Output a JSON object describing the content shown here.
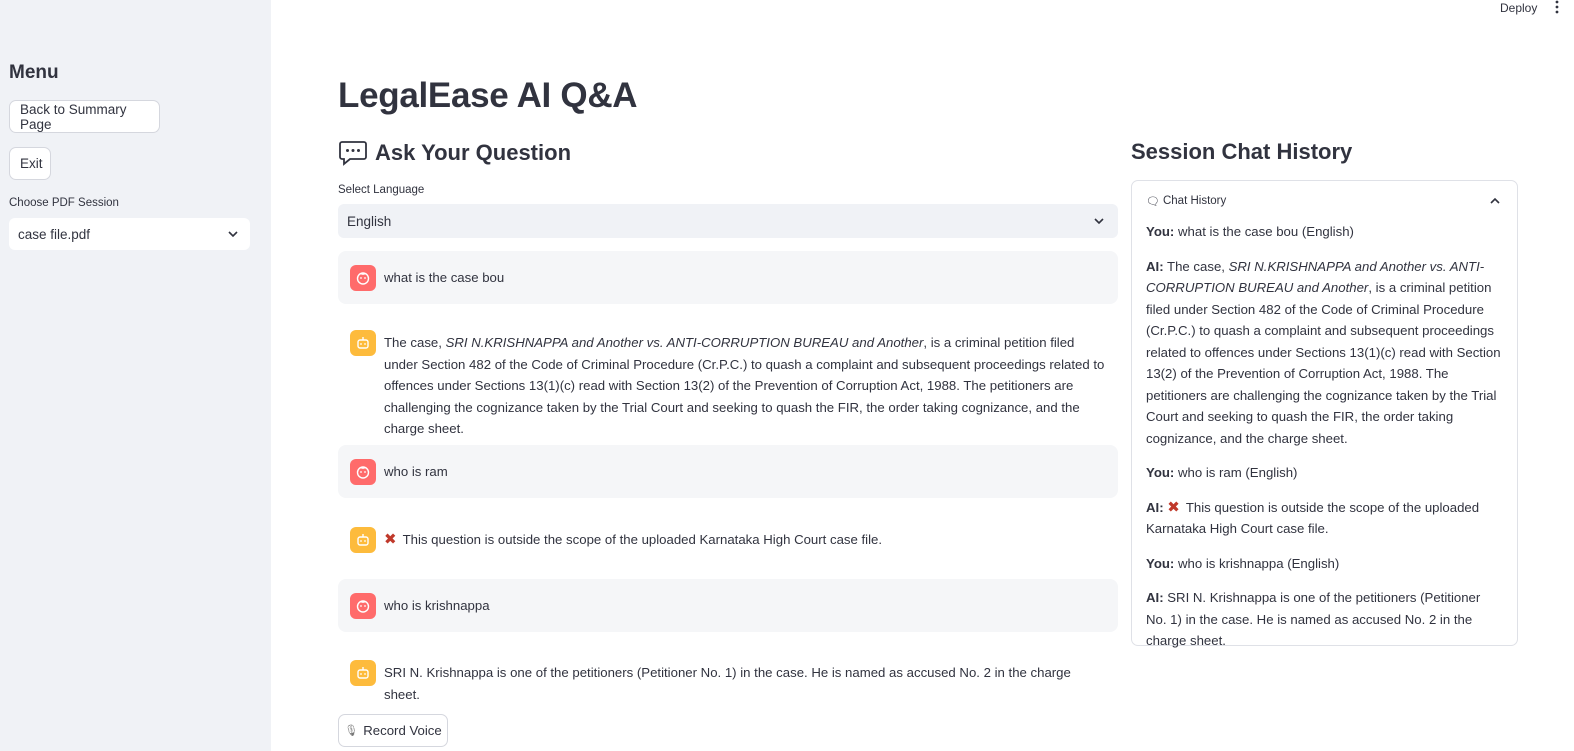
{
  "topbar": {
    "deploy_label": "Deploy",
    "menu_icon": "kebab-menu-icon"
  },
  "sidebar": {
    "title": "Menu",
    "back_button": "Back to Summary Page",
    "exit_button": "Exit",
    "session_label": "Choose PDF Session",
    "session_value": "case file.pdf"
  },
  "main": {
    "title": "LegalEase AI Q&A",
    "ask_heading": "Ask Your Question",
    "ask_icon": "speech-bubble-icon",
    "language_label": "Select Language",
    "language_value": "English",
    "record_button": "Record Voice",
    "messages": [
      {
        "role": "user",
        "text": "what is the case bou"
      },
      {
        "role": "ai",
        "prefix": "The case, ",
        "italic": "SRI N.KRISHNAPPA and Another vs. ANTI-CORRUPTION BUREAU and Another",
        "suffix": ", is a criminal petition filed under Section 482 of the Code of Criminal Procedure (Cr.P.C.) to quash a complaint and subsequent proceedings related to offences under Sections 13(1)(c) read with Section 13(2) of the Prevention of Corruption Act, 1988. The petitioners are challenging the cognizance taken by the Trial Court and seeking to quash the FIR, the order taking cognizance, and the charge sheet."
      },
      {
        "role": "user",
        "text": "who is ram"
      },
      {
        "role": "ai",
        "text": "This question is outside the scope of the uploaded Karnataka High Court case file."
      },
      {
        "role": "user",
        "text": "who is krishnappa"
      },
      {
        "role": "ai",
        "text": "SRI N. Krishnappa is one of the petitioners (Petitioner No. 1) in the case. He is named as accused No. 2 in the charge sheet."
      }
    ]
  },
  "history": {
    "heading": "Session Chat History",
    "expander_label": "Chat History",
    "you_label": "You:",
    "ai_label": "AI:",
    "entries": [
      {
        "you": "what is the case bou (English)"
      },
      {
        "ai_prefix": "The case, ",
        "ai_italic": "SRI N.KRISHNAPPA and Another vs. ANTI-CORRUPTION BUREAU and Another",
        "ai_suffix": ", is a criminal petition filed under Section 482 of the Code of Criminal Procedure (Cr.P.C.) to quash a complaint and subsequent proceedings related to offences under Sections 13(1)(c) read with Section 13(2) of the Prevention of Corruption Act, 1988. The petitioners are challenging the cognizance taken by the Trial Court and seeking to quash the FIR, the order taking cognizance, and the charge sheet."
      },
      {
        "you": "who is ram (English)"
      },
      {
        "ai": "This question is outside the scope of the uploaded Karnataka High Court case file."
      },
      {
        "you": "who is krishnappa (English)"
      },
      {
        "ai": "SRI N. Krishnappa is one of the petitioners (Petitioner No. 1) in the case. He is named as accused No. 2 in the charge sheet."
      }
    ]
  },
  "colors": {
    "user_avatar": "#ff6b6b",
    "ai_avatar": "#fdbb3c",
    "sidebar_bg": "#f0f2f6",
    "error_x": "#c0392b"
  }
}
